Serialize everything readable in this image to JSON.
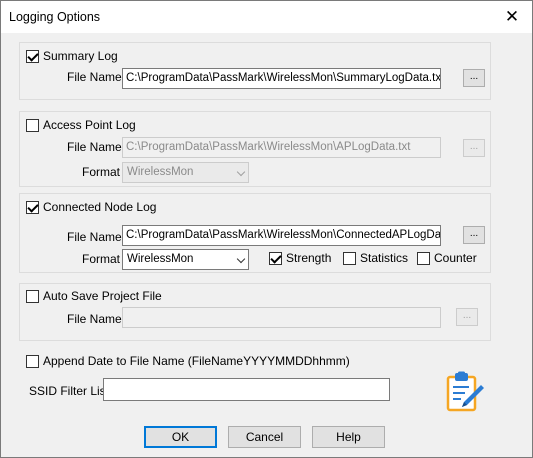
{
  "window": {
    "title": "Logging Options"
  },
  "summary": {
    "label": "Summary Log",
    "checked": true,
    "file_name_label": "File Name",
    "file_name": "C:\\ProgramData\\PassMark\\WirelessMon\\SummaryLogData.txt",
    "browse_label": "..."
  },
  "access_point": {
    "label": "Access Point Log",
    "checked": false,
    "file_name_label": "File Name",
    "file_name": "C:\\ProgramData\\PassMark\\WirelessMon\\APLogData.txt",
    "browse_label": "...",
    "format_label": "Format",
    "format_value": "WirelessMon"
  },
  "connected_node": {
    "label": "Connected Node Log",
    "checked": true,
    "file_name_label": "File Name",
    "file_name": "C:\\ProgramData\\PassMark\\WirelessMon\\ConnectedAPLogData.",
    "browse_label": "...",
    "format_label": "Format",
    "format_value": "WirelessMon",
    "options": [
      {
        "label": "Strength",
        "checked": true
      },
      {
        "label": "Statistics",
        "checked": false
      },
      {
        "label": "Counter",
        "checked": false
      }
    ]
  },
  "auto_save": {
    "label": "Auto Save Project File",
    "checked": false,
    "file_name_label": "File Name",
    "file_name": "",
    "browse_label": "..."
  },
  "append_date": {
    "label": "Append Date to File Name (FileNameYYYYMMDDhhmm)",
    "checked": false
  },
  "ssid_filter": {
    "label": "SSID Filter List",
    "value": ""
  },
  "buttons": {
    "ok": "OK",
    "cancel": "Cancel",
    "help": "Help"
  },
  "icons": {
    "close": "close-icon",
    "clipboard": "clipboard-edit-icon"
  },
  "colors": {
    "accent": "#0078d7",
    "clipboard_blue": "#2b7cd3",
    "clipboard_orange": "#f5a623"
  }
}
